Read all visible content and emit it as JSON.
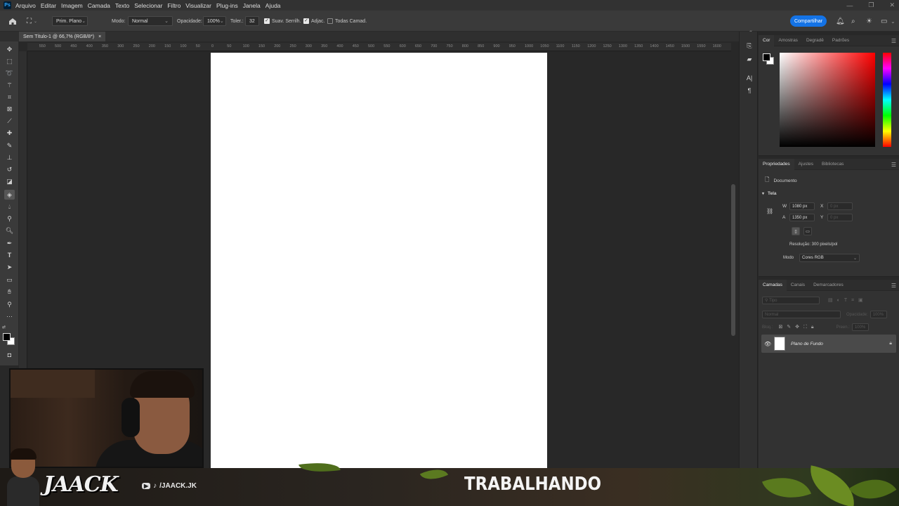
{
  "menubar": {
    "items": [
      "Arquivo",
      "Editar",
      "Imagem",
      "Camada",
      "Texto",
      "Selecionar",
      "Filtro",
      "Visualizar",
      "Plug-ins",
      "Janela",
      "Ajuda"
    ]
  },
  "options": {
    "sample_mode": "Prim. Plano",
    "mode_label": "Modo:",
    "mode_value": "Normal",
    "opacity_label": "Opacidade:",
    "opacity_value": "100%",
    "tolerance_label": "Toler.:",
    "tolerance_value": "32",
    "antialias_label": "Suav. Serrilh.",
    "contiguous_label": "Adjac.",
    "all_layers_label": "Todas Camad.",
    "share_label": "Compartilhar"
  },
  "document_tab": {
    "title": "Sem Título-1 @ 66,7% (RGB/8*)",
    "close": "×"
  },
  "ruler": {
    "labels": [
      "550",
      "500",
      "450",
      "400",
      "350",
      "300",
      "250",
      "200",
      "150",
      "100",
      "50",
      "0",
      "50",
      "100",
      "150",
      "200",
      "250",
      "300",
      "350",
      "400",
      "450",
      "500",
      "550",
      "600",
      "650",
      "700",
      "750",
      "800",
      "850",
      "900",
      "950",
      "1000",
      "1050",
      "1100",
      "1150",
      "1200",
      "1250",
      "1300",
      "1350",
      "1400",
      "1450",
      "1500",
      "1550",
      "1600"
    ]
  },
  "color_panel": {
    "tabs": [
      "Cor",
      "Amostras",
      "Degradê",
      "Padrões"
    ]
  },
  "props_panel": {
    "tabs": [
      "Propriedades",
      "Ajustes",
      "Bibliotecas"
    ],
    "doc_label": "Documento",
    "section": "Tela",
    "w_label": "W",
    "w_value": "1080 px",
    "h_label": "A",
    "h_value": "1350 px",
    "x_label": "X",
    "x_value": "0 px",
    "y_label": "Y",
    "y_value": "0 px",
    "resolution": "Resolução: 300 pixels/pol",
    "mode_label": "Modo",
    "mode_value": "Cores RGB"
  },
  "layers_panel": {
    "tabs": [
      "Camadas",
      "Canais",
      "Demarcadores"
    ],
    "search_placeholder": "Tipo",
    "blend_mode": "Normal",
    "opacity_label": "Opacidade:",
    "opacity_value": "100%",
    "lock_label": "Bloq.:",
    "fill_label": "Preen.:",
    "fill_value": "100%",
    "layer_name": "Plano de Fundo"
  },
  "banner": {
    "brand": "JAACK",
    "social_handle": "/JAACK.JK",
    "status": "TRABALHANDO"
  }
}
